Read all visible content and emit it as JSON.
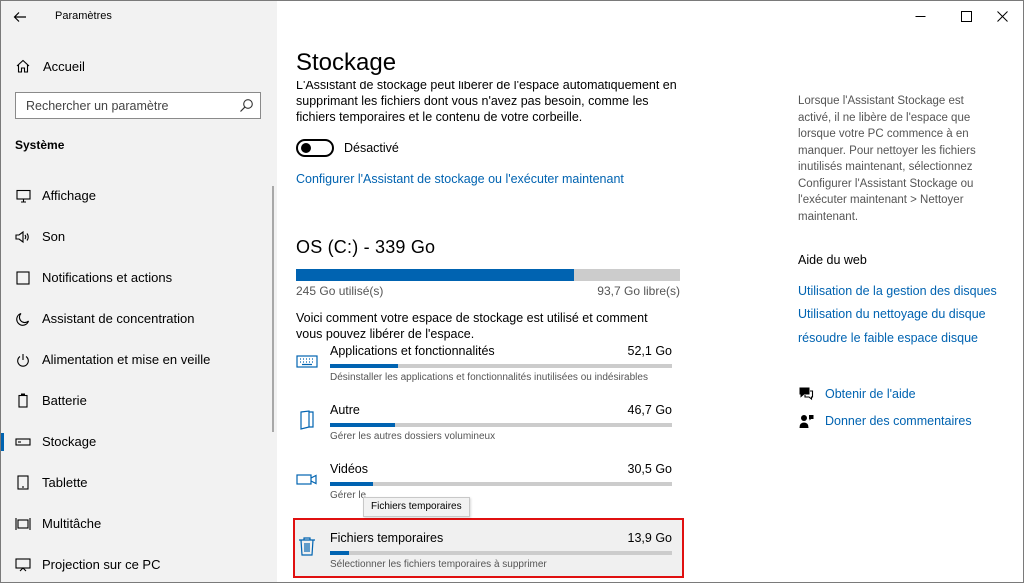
{
  "window": {
    "title": "Paramètres",
    "controls": [
      "minimize",
      "maximize",
      "close"
    ]
  },
  "sidebar": {
    "home_label": "Accueil",
    "search_placeholder": "Rechercher un paramètre",
    "section_label": "Système",
    "items": [
      {
        "label": "Affichage",
        "icon": "monitor-icon"
      },
      {
        "label": "Son",
        "icon": "speaker-icon"
      },
      {
        "label": "Notifications et actions",
        "icon": "notification-icon"
      },
      {
        "label": "Assistant de concentration",
        "icon": "moon-icon"
      },
      {
        "label": "Alimentation et mise en veille",
        "icon": "power-icon"
      },
      {
        "label": "Batterie",
        "icon": "battery-icon"
      },
      {
        "label": "Stockage",
        "icon": "storage-icon",
        "active": true
      },
      {
        "label": "Tablette",
        "icon": "tablet-icon"
      },
      {
        "label": "Multitâche",
        "icon": "multitask-icon"
      },
      {
        "label": "Projection sur ce PC",
        "icon": "projection-icon"
      }
    ]
  },
  "main": {
    "title": "Stockage",
    "intro": "L'Assistant de stockage peut libérer de l'espace automatiquement en supprimant les fichiers dont vous n'avez pas besoin, comme les fichiers temporaires et le contenu de votre corbeille.",
    "toggle_label": "Désactivé",
    "configure_link": "Configurer l'Assistant de stockage ou l'exécuter maintenant",
    "drive": {
      "title": "OS (C:) - 339 Go",
      "used_label": "245 Go utilisé(s)",
      "free_label": "93,7 Go libre(s)",
      "used_fraction": 0.723
    },
    "usage_desc": "Voici comment votre espace de stockage est utilisé et comment vous pouvez libérer de l'espace.",
    "categories": [
      {
        "name": "Applications et fonctionnalités",
        "size": "52,1 Go",
        "desc": "Désinstaller les applications et fonctionnalités inutilisées ou indésirables",
        "fill": 0.2,
        "icon": "keyboard-icon"
      },
      {
        "name": "Autre",
        "size": "46,7 Go",
        "desc": "Gérer les autres dossiers volumineux",
        "fill": 0.19,
        "icon": "document-icon"
      },
      {
        "name": "Vidéos",
        "size": "30,5 Go",
        "desc": "Gérer le",
        "fill": 0.125,
        "icon": "video-icon"
      },
      {
        "name": "Fichiers temporaires",
        "size": "13,9 Go",
        "desc": "Sélectionner les fichiers temporaires à supprimer",
        "fill": 0.057,
        "icon": "trash-icon"
      }
    ],
    "tooltip": "Fichiers temporaires"
  },
  "right": {
    "tip": "Lorsque l'Assistant Stockage est activé, il ne libère de l'espace que lorsque votre PC commence à en manquer. Pour nettoyer les fichiers inutilisés maintenant, sélectionnez Configurer l'Assistant Stockage ou l'exécuter maintenant > Nettoyer maintenant.",
    "web_help_title": "Aide du web",
    "links": [
      "Utilisation de la gestion des disques",
      "Utilisation du nettoyage du disque",
      "résoudre le faible espace disque"
    ],
    "get_help": "Obtenir de l'aide",
    "feedback": "Donner des commentaires"
  },
  "colors": {
    "accent": "#0063b1",
    "highlight": "#e01010",
    "sidebar_bg": "#f2f2f2"
  }
}
